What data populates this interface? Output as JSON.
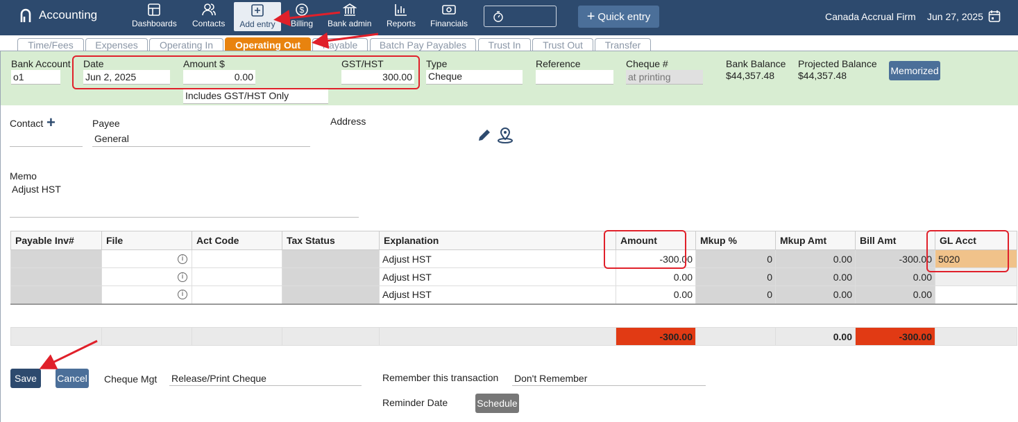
{
  "app": {
    "title": "Accounting"
  },
  "nav": [
    {
      "label": "Dashboards",
      "icon": "dashboard-icon"
    },
    {
      "label": "Contacts",
      "icon": "contacts-icon"
    },
    {
      "label": "Add entry",
      "icon": "add-entry-icon",
      "active": true
    },
    {
      "label": "Billing",
      "icon": "billing-icon"
    },
    {
      "label": "Bank admin",
      "icon": "bank-icon"
    },
    {
      "label": "Reports",
      "icon": "reports-icon"
    },
    {
      "label": "Financials",
      "icon": "financials-icon"
    }
  ],
  "quick_entry": "Quick entry",
  "firm": "Canada Accrual Firm",
  "current_date": "Jun 27, 2025",
  "tabs": [
    "Time/Fees",
    "Expenses",
    "Operating In",
    "Operating Out",
    "Payable",
    "Batch Pay Payables",
    "Trust In",
    "Trust Out",
    "Transfer"
  ],
  "active_tab": "Operating Out",
  "form": {
    "bank_account_label": "Bank Account",
    "bank_account": "o1",
    "date_label": "Date",
    "date": "Jun 2, 2025",
    "amount_label": "Amount $",
    "amount": "0.00",
    "tax_option": "Includes GST/HST Only",
    "gst_label": "GST/HST",
    "gst": "300.00",
    "type_label": "Type",
    "type": "Cheque",
    "reference_label": "Reference",
    "reference": "",
    "cheque_label": "Cheque #",
    "cheque_placeholder": "at printing",
    "bank_balance_label": "Bank Balance",
    "bank_balance": "$44,357.48",
    "projected_balance_label": "Projected Balance",
    "projected_balance": "$44,357.48",
    "memorized": "Memorized",
    "contact_label": "Contact",
    "payee_label": "Payee",
    "payee": "General",
    "address_label": "Address",
    "memo_label": "Memo",
    "memo": "Adjust HST"
  },
  "grid": {
    "headers": [
      "Payable Inv#",
      "File",
      "Act Code",
      "Tax Status",
      "Explanation",
      "Amount",
      "Mkup %",
      "Mkup Amt",
      "Bill Amt",
      "GL Acct"
    ],
    "rows": [
      {
        "explanation": "Adjust HST",
        "amount": "-300.00",
        "mkup_pct": "0",
        "mkup_amt": "0.00",
        "bill_amt": "-300.00",
        "gl_acct": "5020"
      },
      {
        "explanation": "Adjust HST",
        "amount": "0.00",
        "mkup_pct": "0",
        "mkup_amt": "0.00",
        "bill_amt": "0.00",
        "gl_acct": ""
      },
      {
        "explanation": "Adjust HST",
        "amount": "0.00",
        "mkup_pct": "0",
        "mkup_amt": "0.00",
        "bill_amt": "0.00",
        "gl_acct": ""
      }
    ],
    "totals": {
      "amount": "-300.00",
      "mkup_amt": "0.00",
      "bill_amt": "-300.00"
    }
  },
  "footer": {
    "save": "Save",
    "cancel": "Cancel",
    "cheque_mgt_label": "Cheque Mgt",
    "cheque_mgt": "Release/Print Cheque",
    "remember_label": "Remember this transaction",
    "remember": "Don't Remember",
    "reminder_label": "Reminder Date",
    "schedule": "Schedule"
  },
  "colors": {
    "header": "#2d4a6e",
    "accent": "#e8830f",
    "green_panel": "#d8edd2",
    "annotation": "#e0202a"
  }
}
